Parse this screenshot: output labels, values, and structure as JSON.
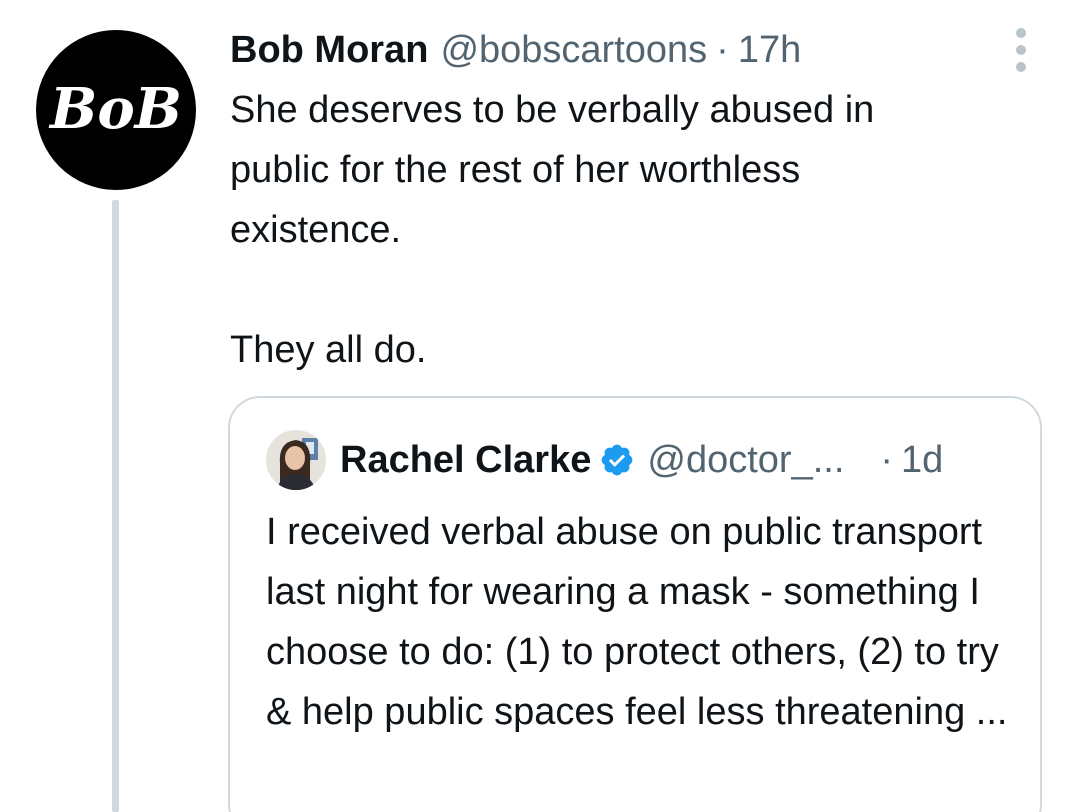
{
  "tweet": {
    "author_name": "Bob Moran",
    "author_handle": "@bobscartoons",
    "separator": "·",
    "time": "17h",
    "avatar_text": "BoB",
    "text": "She deserves to be verbally abused in\npublic for the rest of her worthless\nexistence.\n\nThey all do."
  },
  "quoted_tweet": {
    "author_name": "Rachel Clarke",
    "author_handle": "@doctor_...",
    "separator": "·",
    "time": "1d",
    "verified": true,
    "text": "I received verbal abuse on public transport last night for wearing a mask - something I choose to do: (1) to protect others, (2) to try & help public spaces feel less threatening ..."
  },
  "colors": {
    "text_primary": "#0f1419",
    "text_secondary": "#536471",
    "border": "#cfd9de",
    "verified_blue": "#1d9bf0",
    "avatar_bg": "#000000"
  },
  "icons": {
    "more": "more-vertical-icon",
    "verified": "verified-badge-icon"
  }
}
